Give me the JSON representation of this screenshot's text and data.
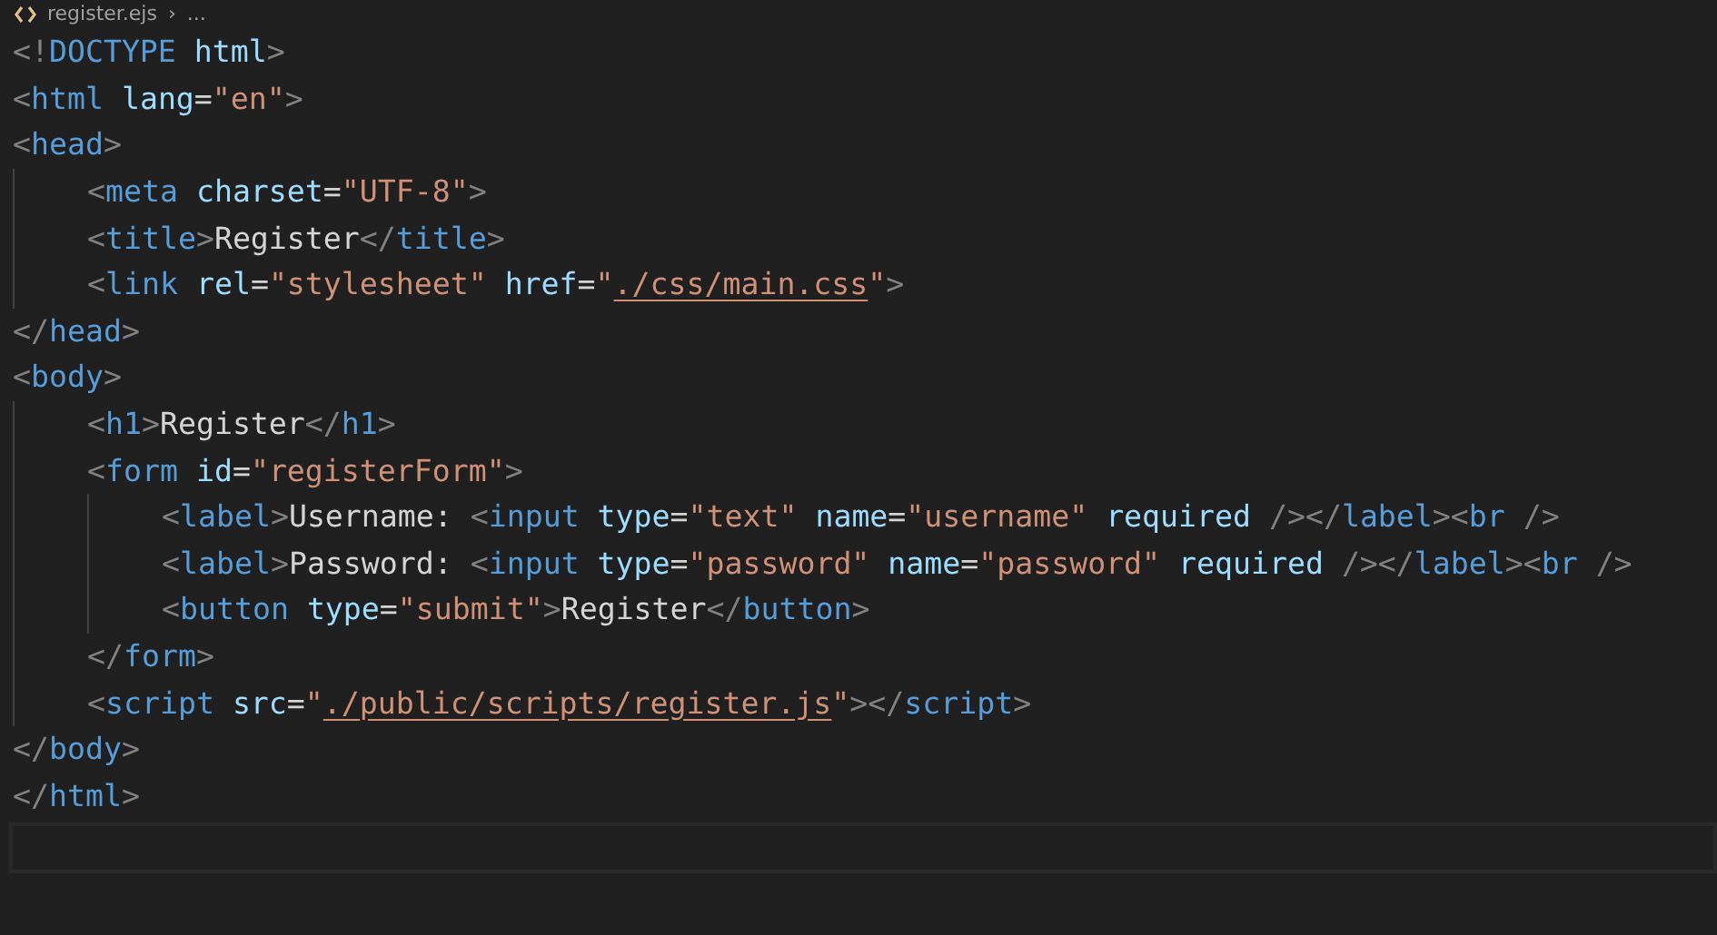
{
  "breadcrumb": {
    "file": "register.ejs",
    "separator": "›",
    "more": "..."
  },
  "lines": [
    {
      "tokens": [
        {
          "kind": "punct",
          "text": "<!"
        },
        {
          "kind": "tag",
          "text": "DOCTYPE"
        },
        {
          "kind": "attr",
          "text": " html"
        },
        {
          "kind": "punct",
          "text": ">"
        }
      ]
    },
    {
      "tokens": [
        {
          "kind": "punct",
          "text": "<"
        },
        {
          "kind": "tag",
          "text": "html"
        },
        {
          "kind": "attr",
          "text": " lang"
        },
        {
          "kind": "plain",
          "text": "="
        },
        {
          "kind": "string",
          "text": "\"en\""
        },
        {
          "kind": "punct",
          "text": ">"
        }
      ]
    },
    {
      "tokens": [
        {
          "kind": "punct",
          "text": "<"
        },
        {
          "kind": "tag",
          "text": "head"
        },
        {
          "kind": "punct",
          "text": ">"
        }
      ],
      "children": [
        {
          "tokens": [
            {
              "kind": "punct",
              "text": "<"
            },
            {
              "kind": "tag",
              "text": "meta"
            },
            {
              "kind": "attr",
              "text": " charset"
            },
            {
              "kind": "plain",
              "text": "="
            },
            {
              "kind": "string",
              "text": "\"UTF-8\""
            },
            {
              "kind": "punct",
              "text": ">"
            }
          ]
        },
        {
          "tokens": [
            {
              "kind": "punct",
              "text": "<"
            },
            {
              "kind": "tag",
              "text": "title"
            },
            {
              "kind": "punct",
              "text": ">"
            },
            {
              "kind": "plain",
              "text": "Register"
            },
            {
              "kind": "punct",
              "text": "</"
            },
            {
              "kind": "tag",
              "text": "title"
            },
            {
              "kind": "punct",
              "text": ">"
            }
          ]
        },
        {
          "tokens": [
            {
              "kind": "punct",
              "text": "<"
            },
            {
              "kind": "tag",
              "text": "link"
            },
            {
              "kind": "attr",
              "text": " rel"
            },
            {
              "kind": "plain",
              "text": "="
            },
            {
              "kind": "string",
              "text": "\"stylesheet\""
            },
            {
              "kind": "attr",
              "text": " href"
            },
            {
              "kind": "plain",
              "text": "="
            },
            {
              "kind": "string",
              "text": "\""
            },
            {
              "kind": "link",
              "text": "./css/main.css"
            },
            {
              "kind": "string",
              "text": "\""
            },
            {
              "kind": "punct",
              "text": ">"
            }
          ]
        }
      ]
    },
    {
      "tokens": [
        {
          "kind": "punct",
          "text": "</"
        },
        {
          "kind": "tag",
          "text": "head"
        },
        {
          "kind": "punct",
          "text": ">"
        }
      ]
    },
    {
      "tokens": [
        {
          "kind": "punct",
          "text": "<"
        },
        {
          "kind": "tag",
          "text": "body"
        },
        {
          "kind": "punct",
          "text": ">"
        }
      ],
      "children": [
        {
          "tokens": [
            {
              "kind": "punct",
              "text": "<"
            },
            {
              "kind": "tag",
              "text": "h1"
            },
            {
              "kind": "punct",
              "text": ">"
            },
            {
              "kind": "plain",
              "text": "Register"
            },
            {
              "kind": "punct",
              "text": "</"
            },
            {
              "kind": "tag",
              "text": "h1"
            },
            {
              "kind": "punct",
              "text": ">"
            }
          ]
        },
        {
          "tokens": [
            {
              "kind": "punct",
              "text": "<"
            },
            {
              "kind": "tag",
              "text": "form"
            },
            {
              "kind": "attr",
              "text": " id"
            },
            {
              "kind": "plain",
              "text": "="
            },
            {
              "kind": "string",
              "text": "\"registerForm\""
            },
            {
              "kind": "punct",
              "text": ">"
            }
          ],
          "children": [
            {
              "tokens": [
                {
                  "kind": "punct",
                  "text": "<"
                },
                {
                  "kind": "tag",
                  "text": "label"
                },
                {
                  "kind": "punct",
                  "text": ">"
                },
                {
                  "kind": "plain",
                  "text": "Username: "
                },
                {
                  "kind": "punct",
                  "text": "<"
                },
                {
                  "kind": "tag",
                  "text": "input"
                },
                {
                  "kind": "attr",
                  "text": " type"
                },
                {
                  "kind": "plain",
                  "text": "="
                },
                {
                  "kind": "string",
                  "text": "\"text\""
                },
                {
                  "kind": "attr",
                  "text": " name"
                },
                {
                  "kind": "plain",
                  "text": "="
                },
                {
                  "kind": "string",
                  "text": "\"username\""
                },
                {
                  "kind": "attr",
                  "text": " required"
                },
                {
                  "kind": "punct",
                  "text": " /></"
                },
                {
                  "kind": "tag",
                  "text": "label"
                },
                {
                  "kind": "punct",
                  "text": "><"
                },
                {
                  "kind": "tag",
                  "text": "br"
                },
                {
                  "kind": "punct",
                  "text": " />"
                }
              ]
            },
            {
              "tokens": [
                {
                  "kind": "punct",
                  "text": "<"
                },
                {
                  "kind": "tag",
                  "text": "label"
                },
                {
                  "kind": "punct",
                  "text": ">"
                },
                {
                  "kind": "plain",
                  "text": "Password: "
                },
                {
                  "kind": "punct",
                  "text": "<"
                },
                {
                  "kind": "tag",
                  "text": "input"
                },
                {
                  "kind": "attr",
                  "text": " type"
                },
                {
                  "kind": "plain",
                  "text": "="
                },
                {
                  "kind": "string",
                  "text": "\"password\""
                },
                {
                  "kind": "attr",
                  "text": " name"
                },
                {
                  "kind": "plain",
                  "text": "="
                },
                {
                  "kind": "string",
                  "text": "\"password\""
                },
                {
                  "kind": "attr",
                  "text": " required"
                },
                {
                  "kind": "punct",
                  "text": " /></"
                },
                {
                  "kind": "tag",
                  "text": "label"
                },
                {
                  "kind": "punct",
                  "text": "><"
                },
                {
                  "kind": "tag",
                  "text": "br"
                },
                {
                  "kind": "punct",
                  "text": " />"
                }
              ]
            },
            {
              "tokens": [
                {
                  "kind": "punct",
                  "text": "<"
                },
                {
                  "kind": "tag",
                  "text": "button"
                },
                {
                  "kind": "attr",
                  "text": " type"
                },
                {
                  "kind": "plain",
                  "text": "="
                },
                {
                  "kind": "string",
                  "text": "\"submit\""
                },
                {
                  "kind": "punct",
                  "text": ">"
                },
                {
                  "kind": "plain",
                  "text": "Register"
                },
                {
                  "kind": "punct",
                  "text": "</"
                },
                {
                  "kind": "tag",
                  "text": "button"
                },
                {
                  "kind": "punct",
                  "text": ">"
                }
              ]
            }
          ]
        },
        {
          "tokens": [
            {
              "kind": "punct",
              "text": "</"
            },
            {
              "kind": "tag",
              "text": "form"
            },
            {
              "kind": "punct",
              "text": ">"
            }
          ]
        },
        {
          "tokens": [
            {
              "kind": "punct",
              "text": "<"
            },
            {
              "kind": "tag",
              "text": "script"
            },
            {
              "kind": "attr",
              "text": " src"
            },
            {
              "kind": "plain",
              "text": "="
            },
            {
              "kind": "string",
              "text": "\""
            },
            {
              "kind": "link",
              "text": "./public/scripts/register.js"
            },
            {
              "kind": "string",
              "text": "\""
            },
            {
              "kind": "punct",
              "text": "></"
            },
            {
              "kind": "tag",
              "text": "script"
            },
            {
              "kind": "punct",
              "text": ">"
            }
          ]
        }
      ]
    },
    {
      "tokens": [
        {
          "kind": "punct",
          "text": "</"
        },
        {
          "kind": "tag",
          "text": "body"
        },
        {
          "kind": "punct",
          "text": ">"
        }
      ]
    },
    {
      "tokens": [
        {
          "kind": "punct",
          "text": "</"
        },
        {
          "kind": "tag",
          "text": "html"
        },
        {
          "kind": "punct",
          "text": ">"
        }
      ]
    }
  ]
}
